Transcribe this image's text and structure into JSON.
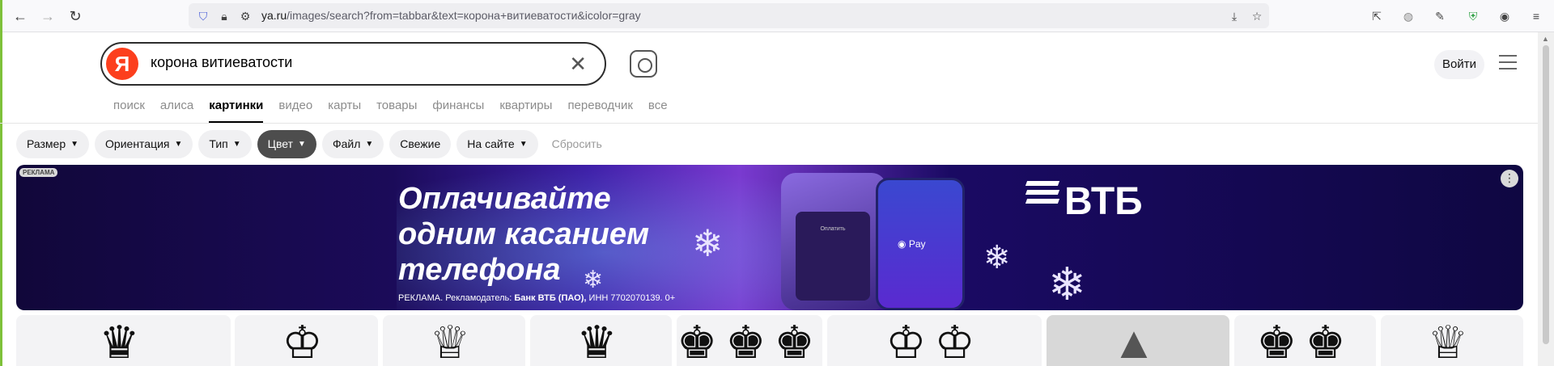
{
  "browser": {
    "url_host": "ya.ru",
    "url_path": "/images/search?from=tabbar&text=корона+витиеватости&icolor=gray"
  },
  "search": {
    "logo": "Я",
    "query": "корона витиеватости"
  },
  "header": {
    "login_label": "Войти"
  },
  "tabs": [
    {
      "label": "поиск"
    },
    {
      "label": "алиса"
    },
    {
      "label": "картинки",
      "active": true
    },
    {
      "label": "видео"
    },
    {
      "label": "карты"
    },
    {
      "label": "товары"
    },
    {
      "label": "финансы"
    },
    {
      "label": "квартиры"
    },
    {
      "label": "переводчик"
    },
    {
      "label": "все"
    }
  ],
  "filters": [
    {
      "label": "Размер",
      "dropdown": true
    },
    {
      "label": "Ориентация",
      "dropdown": true
    },
    {
      "label": "Тип",
      "dropdown": true
    },
    {
      "label": "Цвет",
      "dropdown": true,
      "active": true
    },
    {
      "label": "Файл",
      "dropdown": true
    },
    {
      "label": "Свежие",
      "dropdown": false
    },
    {
      "label": "На сайте",
      "dropdown": true
    }
  ],
  "reset_label": "Сбросить",
  "ad": {
    "badge": "РЕКЛАМА",
    "headline_1": "Оплачивайте",
    "headline_2": "одним касанием",
    "headline_3": "телефона",
    "legal_prefix": "РЕКЛАМА. Рекламодатель:",
    "advertiser": "Банк ВТБ (ПАО),",
    "legal_suffix": "ИНН 7702070139. 0+",
    "brand": "ВТБ",
    "terminal_text": "Оплатить",
    "pay_text": "Pay",
    "accent_colors": [
      "#1b0b59",
      "#3e1fa8",
      "#7a3ad0"
    ]
  },
  "colors": {
    "logo_red": "#fc3f1d",
    "active_chip": "#4d4d4d",
    "chip_bg": "#f0f0f2"
  }
}
